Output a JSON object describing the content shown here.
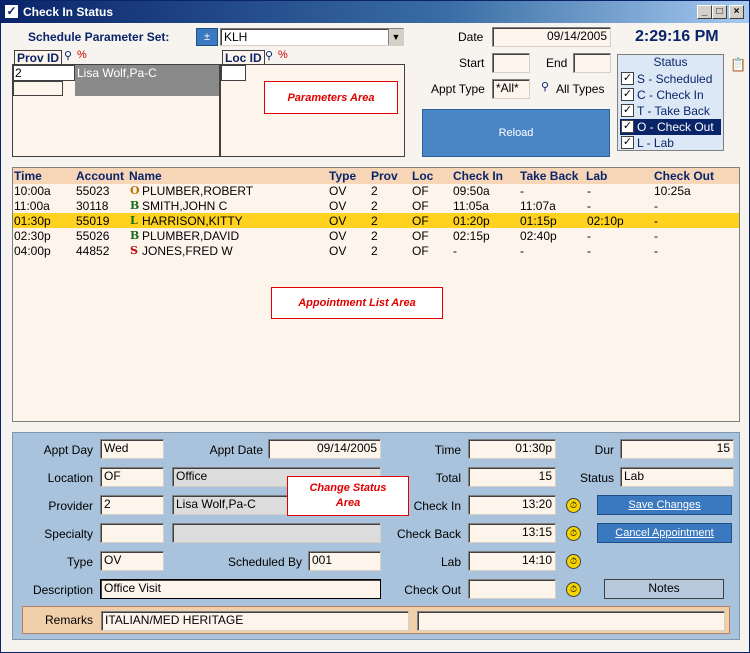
{
  "window": {
    "title": "Check In Status",
    "min": "_",
    "max": "□",
    "close": "×"
  },
  "params": {
    "schedule_label": "Schedule Parameter Set:",
    "schedule_btn": "±",
    "schedule_value": "KLH",
    "prov_id_label": "Prov ID",
    "loc_id_label": "Loc ID",
    "prov_id_value": "2",
    "prov_name": "Lisa Wolf,Pa-C",
    "date_label": "Date",
    "date_value": "09/14/2005",
    "clock": "2:29:16 PM",
    "start_label": "Start",
    "end_label": "End",
    "appt_type_label": "Appt Type",
    "appt_type_value": "*All*",
    "all_types_label": "All Types",
    "reload_label": "Reload",
    "annotation": "Parameters Area"
  },
  "status": {
    "title": "Status",
    "items": [
      {
        "label": "S - Scheduled",
        "checked": "✓"
      },
      {
        "label": "C - Check In",
        "checked": "✓"
      },
      {
        "label": "T - Take Back",
        "checked": "✓"
      },
      {
        "label": "O - Check Out",
        "checked": "✓"
      },
      {
        "label": "L - Lab",
        "checked": "✓"
      }
    ]
  },
  "list": {
    "headers": [
      "Time",
      "Account",
      "Name",
      "Type",
      "Prov",
      "Loc",
      "Check In",
      "Take Back",
      "Lab",
      "Check Out"
    ],
    "rows": [
      {
        "time": "10:00a",
        "account": "55023",
        "badge": "O",
        "name": "PLUMBER,ROBERT",
        "type": "OV",
        "prov": "2",
        "loc": "OF",
        "checkin": "09:50a",
        "takeback": "-",
        "lab": "-",
        "checkout": "10:25a"
      },
      {
        "time": "11:00a",
        "account": "30118",
        "badge": "B",
        "name": "SMITH,JOHN C",
        "type": "OV",
        "prov": "2",
        "loc": "OF",
        "checkin": "11:05a",
        "takeback": "11:07a",
        "lab": "-",
        "checkout": "-"
      },
      {
        "time": "01:30p",
        "account": "55019",
        "badge": "L",
        "name": "HARRISON,KITTY",
        "type": "OV",
        "prov": "2",
        "loc": "OF",
        "checkin": "01:20p",
        "takeback": "01:15p",
        "lab": "02:10p",
        "checkout": "-"
      },
      {
        "time": "02:30p",
        "account": "55026",
        "badge": "B",
        "name": "PLUMBER,DAVID",
        "type": "OV",
        "prov": "2",
        "loc": "OF",
        "checkin": "02:15p",
        "takeback": "02:40p",
        "lab": "-",
        "checkout": "-"
      },
      {
        "time": "04:00p",
        "account": "44852",
        "badge": "S",
        "name": "JONES,FRED W",
        "type": "OV",
        "prov": "2",
        "loc": "OF",
        "checkin": "-",
        "takeback": "-",
        "lab": "-",
        "checkout": "-"
      }
    ],
    "annotation": "Appointment List Area"
  },
  "change": {
    "appt_day_label": "Appt Day",
    "appt_day": "Wed",
    "appt_date_label": "Appt Date",
    "appt_date": "09/14/2005",
    "time_label": "Time",
    "time": "01:30p",
    "dur_label": "Dur",
    "dur": "15",
    "location_label": "Location",
    "location_code": "OF",
    "location_name": "Office",
    "total_label": "Total",
    "total": "15",
    "status_label": "Status",
    "status": "Lab",
    "provider_label": "Provider",
    "provider_code": "2",
    "provider_name": "Lisa Wolf,Pa-C",
    "checkin_label": "Check In",
    "checkin": "13:20",
    "specialty_label": "Specialty",
    "checkback_label": "Check Back",
    "checkback": "13:15",
    "type_label": "Type",
    "type": "OV",
    "scheduled_by_label": "Scheduled By",
    "scheduled_by": "001",
    "lab_label": "Lab",
    "lab": "14:10",
    "description_label": "Description",
    "description": "Office Visit",
    "checkout_label": "Check Out",
    "save_label": "Save Changes",
    "cancel_label": "Cancel Appointment",
    "notes_label": "Notes",
    "remarks_label": "Remarks",
    "remarks": "ITALIAN/MED HERITAGE",
    "annotation_line1": "Change Status",
    "annotation_line2": "Area"
  },
  "colors": {
    "selected_row": "#ffd21f",
    "header_bg": "#f7d6b8",
    "accent": "#0a246a",
    "annotation": "#e00000"
  }
}
